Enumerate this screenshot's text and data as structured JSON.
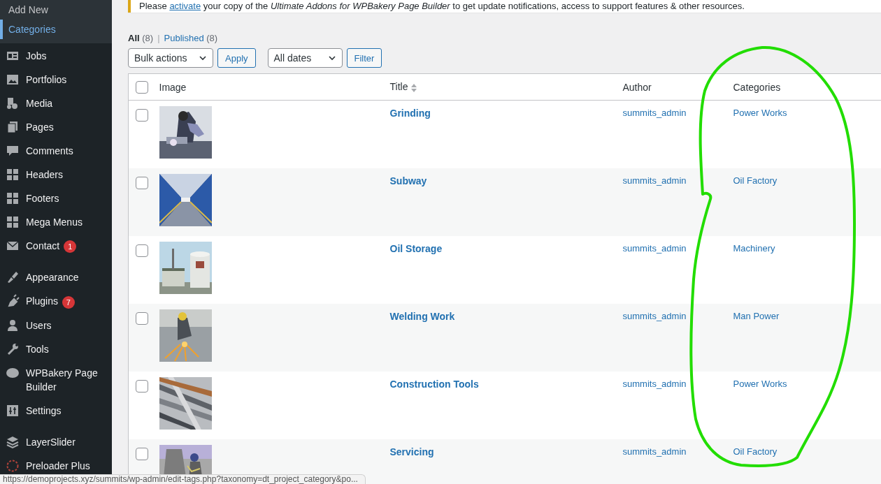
{
  "sidebar": {
    "submenu": [
      {
        "label": "Add New",
        "selected": false
      },
      {
        "label": "Categories",
        "selected": true
      }
    ],
    "menu_groups": [
      [
        {
          "label": "Jobs"
        },
        {
          "label": "Portfolios"
        },
        {
          "label": "Media"
        },
        {
          "label": "Pages"
        },
        {
          "label": "Comments"
        },
        {
          "label": "Headers"
        },
        {
          "label": "Footers"
        },
        {
          "label": "Mega Menus"
        },
        {
          "label": "Contact",
          "badge": "1"
        }
      ],
      [
        {
          "label": "Appearance"
        },
        {
          "label": "Plugins",
          "badge": "7"
        },
        {
          "label": "Users"
        },
        {
          "label": "Tools"
        },
        {
          "label": "WPBakery Page Builder"
        },
        {
          "label": "Settings"
        }
      ],
      [
        {
          "label": "LayerSlider"
        },
        {
          "label": "Preloader Plus"
        }
      ]
    ]
  },
  "notice": {
    "before": "Please ",
    "link": "activate",
    "after": " your copy of the *Ultimate Addons for WPBakery Page Builder* to get update notifications, access to support features & other resources."
  },
  "views_separator": "|",
  "views": [
    {
      "label": "All",
      "count": "(8)",
      "selected": true
    },
    {
      "label": "Published",
      "count": "(8)",
      "selected": false
    }
  ],
  "filters": {
    "bulk_select": "Bulk actions",
    "apply": "Apply",
    "date_select": "All dates",
    "filter": "Filter"
  },
  "table": {
    "select_all": {
      "checked": false
    },
    "columns": [
      "Image",
      "Title",
      "Author",
      "Categories"
    ],
    "rows": [
      {
        "checked": false,
        "title": "Grinding",
        "author": "summits_admin",
        "category": "Power Works"
      },
      {
        "checked": false,
        "title": "Subway",
        "author": "summits_admin",
        "category": "Oil Factory"
      },
      {
        "checked": false,
        "title": "Oil Storage",
        "author": "summits_admin",
        "category": "Machinery"
      },
      {
        "checked": false,
        "title": "Welding Work",
        "author": "summits_admin",
        "category": "Man Power"
      },
      {
        "checked": false,
        "title": "Construction Tools",
        "author": "summits_admin",
        "category": "Power Works"
      },
      {
        "checked": false,
        "title": "Servicing",
        "author": "summits_admin",
        "category": "Oil Factory"
      }
    ]
  },
  "status_url": "https://demoprojects.xyz/summits/wp-admin/edit-tags.php?taxonomy=dt_project_category&po..."
}
